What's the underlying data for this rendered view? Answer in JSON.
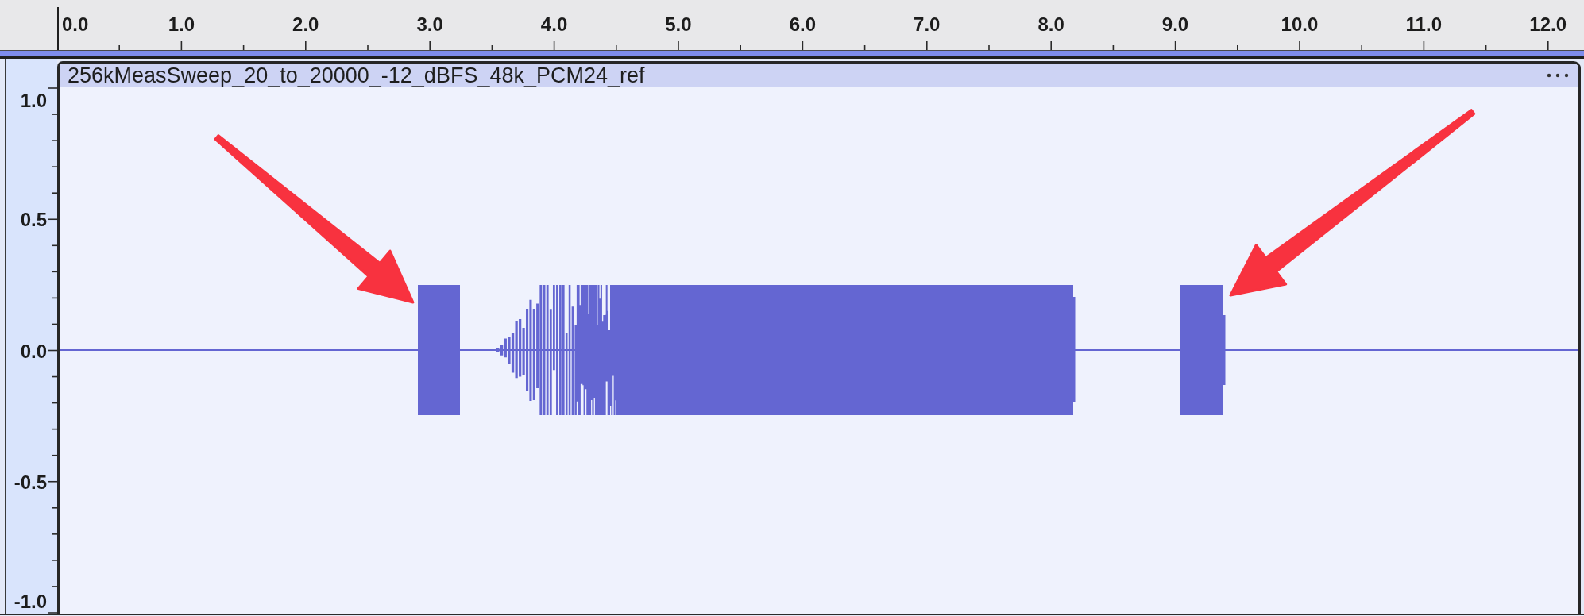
{
  "time_ruler": {
    "labels": [
      "0.0",
      "1.0",
      "2.0",
      "3.0",
      "4.0",
      "5.0",
      "6.0",
      "7.0",
      "8.0",
      "9.0",
      "10.0",
      "11.0",
      "12.0"
    ]
  },
  "amplitude_scale": {
    "labels": [
      "1.0",
      "0.5",
      "0.0",
      "-0.5",
      "-1.0"
    ]
  },
  "track": {
    "title": "256kMeasSweep_20_to_20000_-12_dBFS_48k_PCM24_ref"
  },
  "annotations": [
    {
      "kind": "arrow"
    },
    {
      "kind": "arrow"
    }
  ]
}
